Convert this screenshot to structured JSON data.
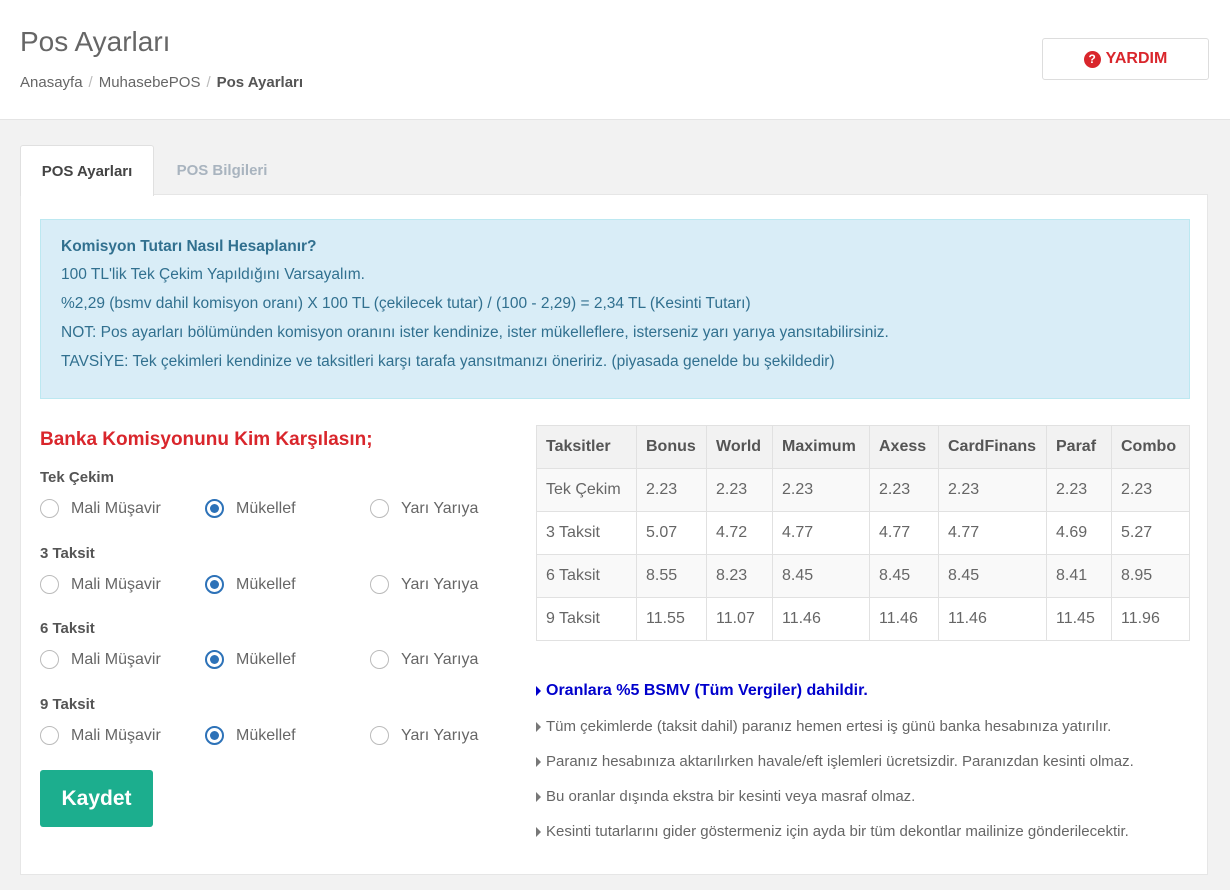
{
  "header": {
    "title": "Pos Ayarları",
    "breadcrumb": [
      "Anasayfa",
      "MuhasebePOS",
      "Pos Ayarları"
    ],
    "help_label": "YARDIM",
    "help_icon": "?"
  },
  "tabs": [
    {
      "label": "POS Ayarları",
      "active": true
    },
    {
      "label": "POS Bilgileri",
      "active": false
    }
  ],
  "info": {
    "title": "Komisyon Tutarı Nasıl Hesaplanır?",
    "lines": [
      "100 TL'lik Tek Çekim Yapıldığını Varsayalım.",
      "%2,29 (bsmv dahil komisyon oranı) X 100 TL (çekilecek tutar) / (100 - 2,29) = 2,34 TL (Kesinti Tutarı)",
      "NOT: Pos ayarları bölümünden komisyon oranını ister kendinize, ister mükelleflere, isterseniz yarı yarıya yansıtabilirsiniz.",
      "TAVSİYE: Tek çekimleri kendinize ve taksitleri karşı tarafa yansıtmanızı öneririz. (piyasada genelde bu şekildedir)"
    ]
  },
  "commission": {
    "title": "Banka Komisyonunu Kim Karşılasın;",
    "options": [
      "Mali Müşavir",
      "Mükellef",
      "Yarı Yarıya"
    ],
    "groups": [
      {
        "label": "Tek Çekim",
        "selected": "Mükellef"
      },
      {
        "label": "3 Taksit",
        "selected": "Mükellef"
      },
      {
        "label": "6 Taksit",
        "selected": "Mükellef"
      },
      {
        "label": "9 Taksit",
        "selected": "Mükellef"
      }
    ],
    "save_label": "Kaydet"
  },
  "rates_table": {
    "headers": [
      "Taksitler",
      "Bonus",
      "World",
      "Maximum",
      "Axess",
      "CardFinans",
      "Paraf",
      "Combo"
    ],
    "rows": [
      [
        "Tek Çekim",
        "2.23",
        "2.23",
        "2.23",
        "2.23",
        "2.23",
        "2.23",
        "2.23"
      ],
      [
        "3 Taksit",
        "5.07",
        "4.72",
        "4.77",
        "4.77",
        "4.77",
        "4.69",
        "5.27"
      ],
      [
        "6 Taksit",
        "8.55",
        "8.23",
        "8.45",
        "8.45",
        "8.45",
        "8.41",
        "8.95"
      ],
      [
        "9 Taksit",
        "11.55",
        "11.07",
        "11.46",
        "11.46",
        "11.46",
        "11.45",
        "11.96"
      ]
    ]
  },
  "notes": {
    "highlight": "Oranlara %5 BSMV (Tüm Vergiler) dahildir.",
    "items": [
      "Tüm çekimlerde (taksit dahil) paranız hemen ertesi iş günü banka hesabınıza yatırılır.",
      "Paranız hesabınıza aktarılırken havale/eft işlemleri ücretsizdir. Paranızdan kesinti olmaz.",
      "Bu oranlar dışında ekstra bir kesinti veya masraf olmaz.",
      "Kesinti tutarlarını gider göstermeniz için ayda bir tüm dekontlar mailinize gönderilecektir."
    ]
  },
  "colors": {
    "accent_red": "#d9262c",
    "save_green": "#1cae8e",
    "info_bg": "#d9edf7",
    "radio_blue": "#2d72b8",
    "note_blue": "#0000cc"
  }
}
